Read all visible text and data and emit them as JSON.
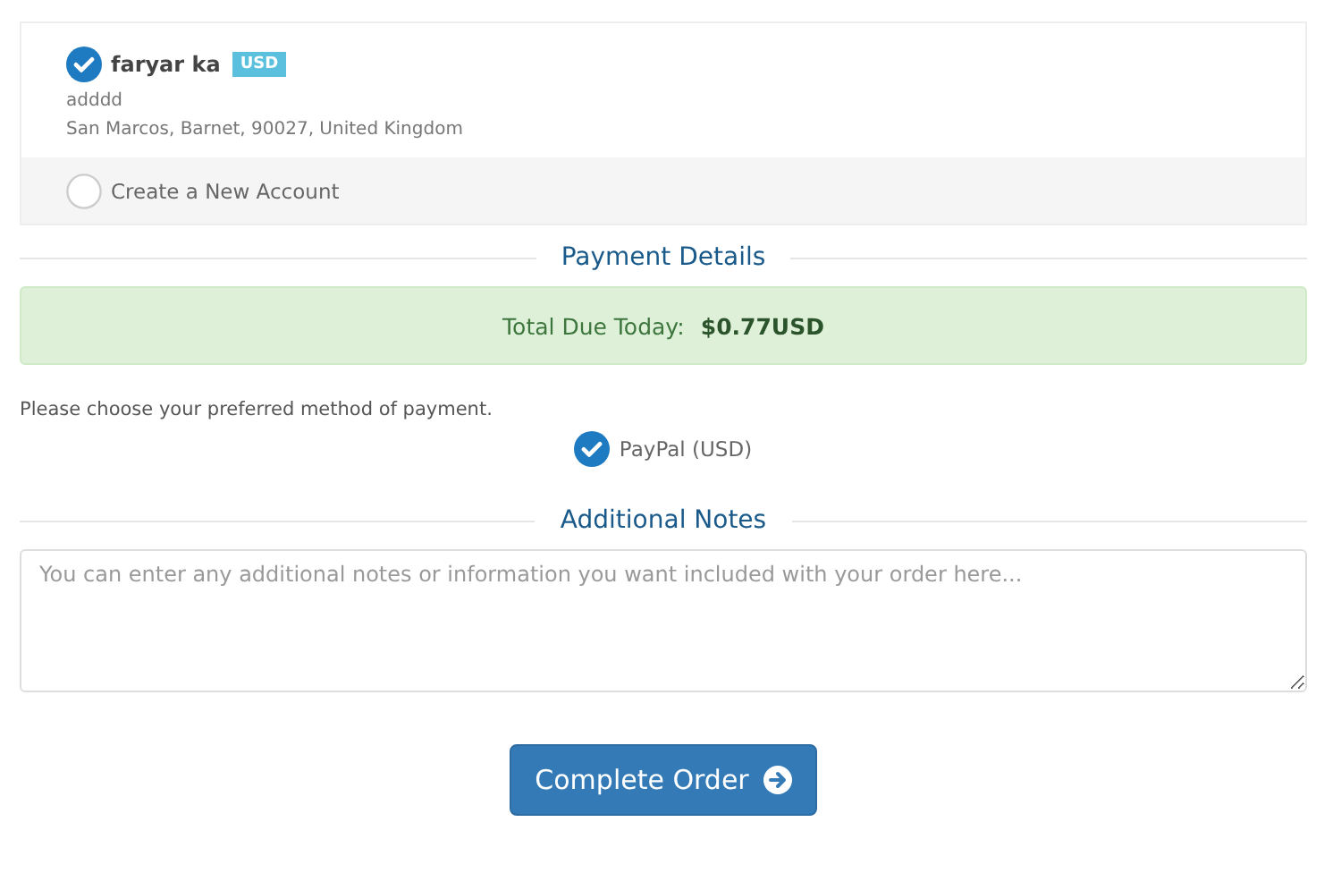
{
  "accounts": [
    {
      "name": "faryar ka",
      "badge": "USD",
      "lines": [
        "adddd",
        "San Marcos, Barnet, 90027, United Kingdom"
      ],
      "selected": true
    },
    {
      "name": "Create a New Account",
      "selected": false
    }
  ],
  "payment_heading": "Payment Details",
  "total": {
    "label": "Total Due Today:",
    "amount": "$0.77USD"
  },
  "payment_prompt": "Please choose your preferred method of payment.",
  "payment_methods": [
    {
      "label": "PayPal (USD)",
      "selected": true
    }
  ],
  "notes_heading": "Additional Notes",
  "notes": {
    "placeholder": "You can enter any additional notes or information you want included with your order here..."
  },
  "submit": {
    "label": "Complete Order"
  }
}
